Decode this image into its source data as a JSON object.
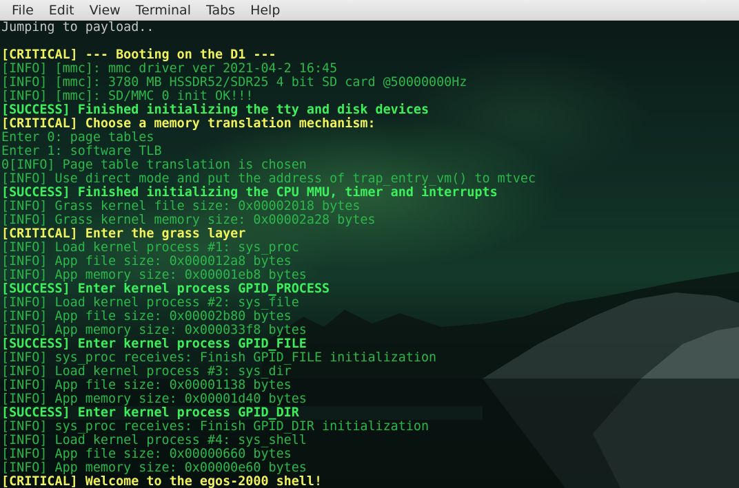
{
  "menu": {
    "items": [
      "File",
      "Edit",
      "View",
      "Terminal",
      "Tabs",
      "Help"
    ]
  },
  "colors": {
    "default": "#c8c8c8",
    "info": "#2bb84a",
    "success": "#3cf05c",
    "critical": "#f2f25a"
  },
  "terminal": {
    "lines": [
      {
        "type": "default",
        "text": "Jumping to payload.."
      },
      {
        "type": "default",
        "text": ""
      },
      {
        "type": "critical",
        "text": "[CRITICAL] --- Booting on the D1 ---"
      },
      {
        "type": "info",
        "text": "[INFO] [mmc]: mmc driver ver 2021-04-2 16:45"
      },
      {
        "type": "info",
        "text": "[INFO] [mmc]: 3780 MB HSSDR52/SDR25 4 bit SD card @50000000Hz"
      },
      {
        "type": "info",
        "text": "[INFO] [mmc]: SD/MMC 0 init OK!!!"
      },
      {
        "type": "success",
        "text": "[SUCCESS] Finished initializing the tty and disk devices"
      },
      {
        "type": "critical",
        "text": "[CRITICAL] Choose a memory translation mechanism:"
      },
      {
        "type": "info",
        "text": "Enter 0: page tables"
      },
      {
        "type": "info",
        "text": "Enter 1: software TLB"
      },
      {
        "type": "info",
        "text": "0[INFO] Page table translation is chosen"
      },
      {
        "type": "info",
        "text": "[INFO] Use direct mode and put the address of trap_entry_vm() to mtvec"
      },
      {
        "type": "success",
        "text": "[SUCCESS] Finished initializing the CPU MMU, timer and interrupts"
      },
      {
        "type": "info",
        "text": "[INFO] Grass kernel file size: 0x00002018 bytes"
      },
      {
        "type": "info",
        "text": "[INFO] Grass kernel memory size: 0x00002a28 bytes"
      },
      {
        "type": "critical",
        "text": "[CRITICAL] Enter the grass layer"
      },
      {
        "type": "info",
        "text": "[INFO] Load kernel process #1: sys_proc"
      },
      {
        "type": "info",
        "text": "[INFO] App file size: 0x000012a8 bytes"
      },
      {
        "type": "info",
        "text": "[INFO] App memory size: 0x00001eb8 bytes"
      },
      {
        "type": "success",
        "text": "[SUCCESS] Enter kernel process GPID_PROCESS"
      },
      {
        "type": "info",
        "text": "[INFO] Load kernel process #2: sys_file"
      },
      {
        "type": "info",
        "text": "[INFO] App file size: 0x00002b80 bytes"
      },
      {
        "type": "info",
        "text": "[INFO] App memory size: 0x000033f8 bytes"
      },
      {
        "type": "success",
        "text": "[SUCCESS] Enter kernel process GPID_FILE"
      },
      {
        "type": "info",
        "text": "[INFO] sys_proc receives: Finish GPID_FILE initialization"
      },
      {
        "type": "info",
        "text": "[INFO] Load kernel process #3: sys_dir"
      },
      {
        "type": "info",
        "text": "[INFO] App file size: 0x00001138 bytes"
      },
      {
        "type": "info",
        "text": "[INFO] App memory size: 0x00001d40 bytes"
      },
      {
        "type": "success",
        "text": "[SUCCESS] Enter kernel process GPID_DIR"
      },
      {
        "type": "info",
        "text": "[INFO] sys_proc receives: Finish GPID_DIR initialization"
      },
      {
        "type": "info",
        "text": "[INFO] Load kernel process #4: sys_shell"
      },
      {
        "type": "info",
        "text": "[INFO] App file size: 0x00000660 bytes"
      },
      {
        "type": "info",
        "text": "[INFO] App memory size: 0x00000e60 bytes"
      },
      {
        "type": "critical",
        "text": "[CRITICAL] Welcome to the egos-2000 shell!"
      }
    ]
  }
}
